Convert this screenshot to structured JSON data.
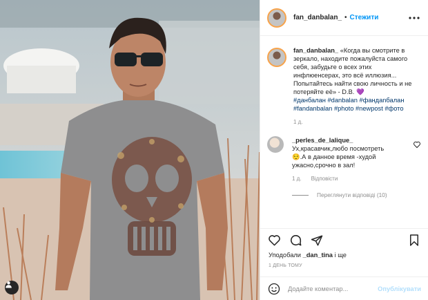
{
  "post": {
    "author": "fan_danbalan_",
    "follow_label": "Стежити",
    "dot": "•"
  },
  "caption": {
    "username": "fan_danbalan_",
    "text": "«Когда вы смотрите в зеркало, находите пожалуйста самого себя, забудьте о всех этих инфлюенсерах, это всё иллюзия... Попытайтесь найти свою личность и не потеряйте её» - D.B.",
    "heart": "💜",
    "hashtags": [
      "#данбалан",
      "#danbalan",
      "#фандanбалан",
      "#fandanbalan",
      "#photo",
      "#newpost",
      "#фото"
    ],
    "time": "1 д."
  },
  "comment": {
    "username": "_perles_de_lalique_",
    "text_line1": "Ух,красавчик,любо посмотреть",
    "text_line2": "😌.А в данное время -худой ужасно,срочно в зал!",
    "time": "1 д.",
    "reply_label": "Відповісти",
    "view_replies": "Переглянути відповіді (10)"
  },
  "likes": {
    "prefix": "Уподобали ",
    "user": "_dan_tina",
    "suffix": " і ще"
  },
  "posted_ago": "1 ДЕНЬ ТОМУ",
  "composer": {
    "placeholder": "Додайте коментар...",
    "publish_label": "Опублікувати"
  },
  "icons": {
    "header_more": "more-horizontal-icon",
    "like": "heart-icon",
    "comment": "comment-icon",
    "share": "paper-plane-icon",
    "save": "bookmark-icon",
    "emoji": "smiley-icon",
    "user_tag": "person-icon"
  },
  "colors": {
    "link_blue": "#0095f6",
    "hashtag": "#00376b",
    "muted": "#8e8e8e",
    "publish_disabled": "#b2dffc"
  }
}
